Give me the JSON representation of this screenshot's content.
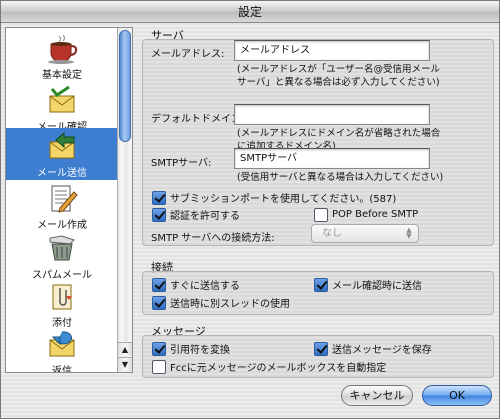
{
  "window": {
    "title": "設定"
  },
  "sidebar": {
    "items": [
      {
        "label": "基本設定",
        "icon": "coffee-cup-icon"
      },
      {
        "label": "メール確認",
        "icon": "envelope-check-icon"
      },
      {
        "label": "メール送信",
        "icon": "envelope-send-icon",
        "selected": true
      },
      {
        "label": "メール作成",
        "icon": "compose-pencil-icon"
      },
      {
        "label": "スパムメール",
        "icon": "spam-trash-icon"
      },
      {
        "label": "添付",
        "icon": "attachment-icon"
      },
      {
        "label": "返信",
        "icon": "reply-icon"
      }
    ]
  },
  "server": {
    "section_title": "サーバ",
    "email_label": "メールアドレス:",
    "email_value": "メールアドレス",
    "email_note": "(メールアドレスが「ユーザー名@受信用メールサーバ」と異なる場合は必ず入力してください)",
    "domain_label": "デフォルトドメイン:",
    "domain_value": "",
    "domain_note": "(メールアドレスにドメイン名が省略された場合に追加するドメイン名)",
    "smtp_label": "SMTPサーバ:",
    "smtp_value": "SMTPサーバ",
    "smtp_note": "(受信用サーバと異なる場合は入力してください)",
    "submission_port_label": "サブミッションポートを使用してください。(587)",
    "submission_port_checked": true,
    "auth_label": "認証を許可する",
    "auth_checked": true,
    "pop_before_smtp_label": "POP Before SMTP",
    "pop_before_smtp_checked": false,
    "connection_label": "SMTP サーバへの接続方法:",
    "connection_value": "なし"
  },
  "connection": {
    "section_title": "接続",
    "send_now_label": "すぐに送信する",
    "send_now_checked": true,
    "send_on_check_label": "メール確認時に送信",
    "send_on_check_checked": true,
    "separate_thread_label": "送信時に別スレッドの使用",
    "separate_thread_checked": true
  },
  "message": {
    "section_title": "メッセージ",
    "convert_quotes_label": "引用符を変換",
    "convert_quotes_checked": true,
    "save_sent_label": "送信メッセージを保存",
    "save_sent_checked": true,
    "fcc_label": "Fccに元メッセージのメールボックスを自動指定",
    "fcc_checked": false
  },
  "buttons": {
    "cancel": "キャンセル",
    "ok": "OK"
  },
  "colors": {
    "selection": "#3d7ed0",
    "default_button": "#3f86df"
  }
}
